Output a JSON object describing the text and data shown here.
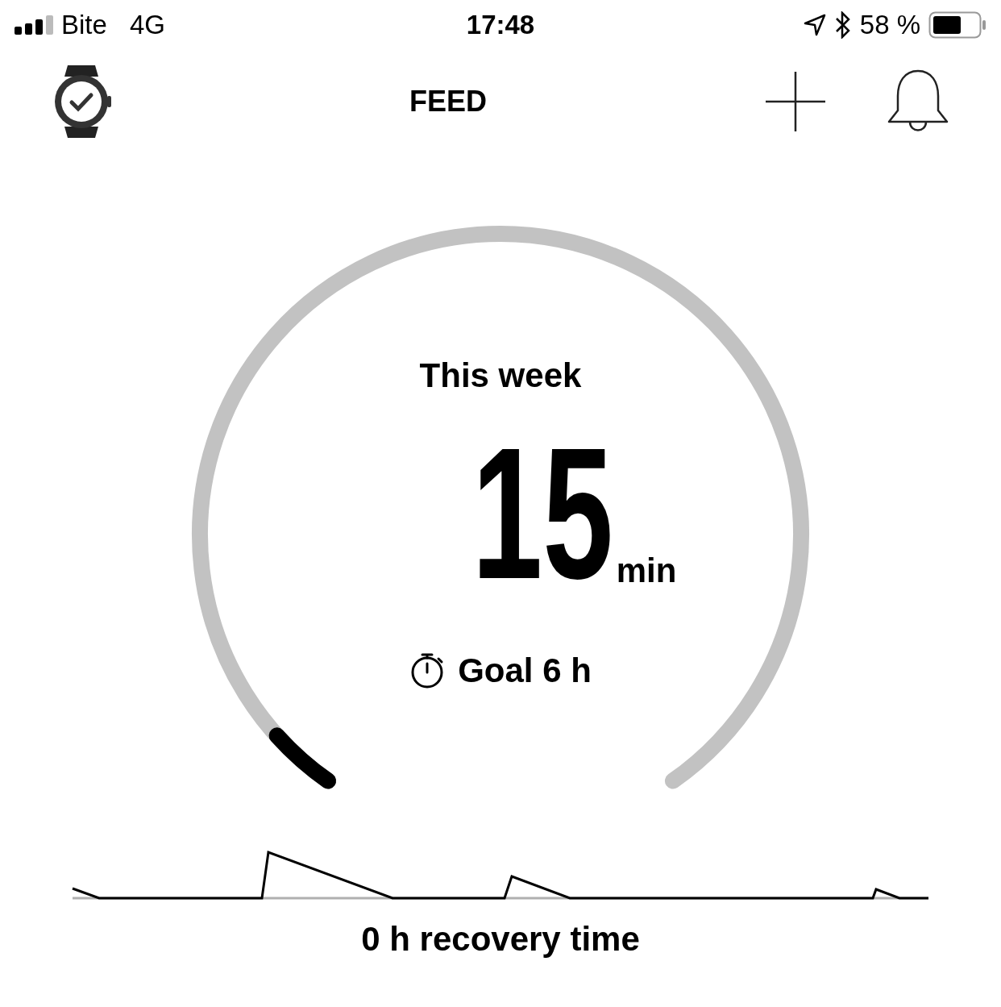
{
  "status_bar": {
    "carrier": "Bite",
    "network": "4G",
    "time": "17:48",
    "battery_percent": "58 %"
  },
  "header": {
    "title": "FEED"
  },
  "gauge": {
    "label": "This week",
    "value": "15",
    "unit": "min",
    "goal": "Goal 6 h"
  },
  "recovery": {
    "text": "0 h recovery time"
  }
}
